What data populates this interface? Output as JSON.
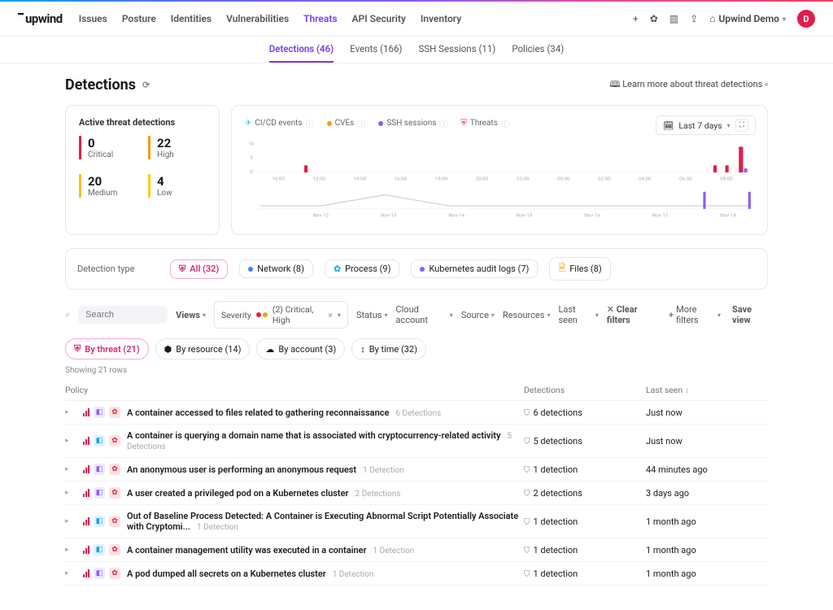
{
  "brand": "upwind",
  "nav": {
    "items": [
      {
        "label": "Issues"
      },
      {
        "label": "Posture"
      },
      {
        "label": "Identities"
      },
      {
        "label": "Vulnerabilities"
      },
      {
        "label": "Threats",
        "active": true
      },
      {
        "label": "API Security"
      },
      {
        "label": "Inventory"
      }
    ]
  },
  "header_right": {
    "org": "Upwind Demo",
    "avatar_initial": "D"
  },
  "subnav": {
    "items": [
      {
        "label": "Detections (46)",
        "active": true
      },
      {
        "label": "Events (166)"
      },
      {
        "label": "SSH Sessions (11)"
      },
      {
        "label": "Policies (34)"
      }
    ]
  },
  "page_title": "Detections",
  "learn_more": "Learn more about threat detections",
  "metrics": {
    "title": "Active threat detections",
    "critical": {
      "value": "0",
      "label": "Critical"
    },
    "high": {
      "value": "22",
      "label": "High"
    },
    "medium": {
      "value": "20",
      "label": "Medium"
    },
    "low": {
      "value": "4",
      "label": "Low"
    }
  },
  "chart_data": {
    "type": "bar",
    "title": "",
    "ylim": [
      0,
      10
    ],
    "legend": [
      "CI/CD events",
      "CVEs",
      "SSH sessions",
      "Threats"
    ],
    "legend_colors": {
      "CI/CD events": "#38bdf8",
      "CVEs": "#f59e0b",
      "SSH sessions": "#8b5cf6",
      "Threats": "#e11d48"
    },
    "timerange_label": "Last 7 days",
    "x_upper_ticks": [
      "10:00",
      "12:00",
      "14:00",
      "16:00",
      "18:00",
      "20:00",
      "22:00",
      "00:00",
      "02:00",
      "04:00",
      "06:00",
      "08:00"
    ],
    "x_lower_ticks": [
      "Nov 12",
      "Nov 13",
      "Nov 14",
      "Nov 15",
      "Nov 16",
      "Nov 17",
      "Nov 18"
    ],
    "series_upper": [
      {
        "name": "Threats",
        "values": [
          0,
          0,
          2,
          0,
          0,
          0,
          0,
          0,
          0,
          0,
          0,
          0,
          2,
          2,
          8
        ]
      },
      {
        "name": "SSH sessions",
        "values": [
          0,
          0,
          0,
          0,
          0,
          0,
          0,
          0,
          0,
          0,
          0,
          0,
          0,
          0,
          1
        ]
      }
    ],
    "series_lower": [
      {
        "name": "events",
        "values": [
          1,
          1,
          3,
          1,
          1,
          1,
          1,
          1,
          1
        ]
      },
      {
        "name": "SSH sessions",
        "values": [
          0,
          0,
          0,
          0,
          0,
          0,
          0,
          0,
          1
        ]
      }
    ]
  },
  "detection_type": {
    "label": "Detection type",
    "pills": [
      {
        "label": "All (32)",
        "active": true,
        "color": "#db2777"
      },
      {
        "label": "Network (8)",
        "color": "#3b82f6"
      },
      {
        "label": "Process (9)",
        "color": "#0ea5e9"
      },
      {
        "label": "Kubernetes audit logs (7)",
        "color": "#8b5cf6"
      },
      {
        "label": "Files (8)",
        "color": "#f59e0b"
      }
    ]
  },
  "filters": {
    "search_placeholder": "Search",
    "views": "Views",
    "severity_label": "Severity",
    "severity_value": "(2) Critical, High",
    "dd": [
      "Status",
      "Cloud account",
      "Source",
      "Resources",
      "Last seen"
    ],
    "clear": "Clear filters",
    "more": "More filters",
    "save": "Save view"
  },
  "grouping": {
    "tabs": [
      {
        "label": "By threat (21)",
        "active": true
      },
      {
        "label": "By resource (14)"
      },
      {
        "label": "By account (3)"
      },
      {
        "label": "By time (32)"
      }
    ]
  },
  "rows_count": "Showing 21 rows",
  "columns": {
    "policy": "Policy",
    "detections": "Detections",
    "last": "Last seen"
  },
  "rows": [
    {
      "icon_bg": "#ede9fe",
      "icon_fg": "#8b5cf6",
      "threat_bg": "#fee2e2",
      "title": "A container accessed to files related to gathering reconnaissance",
      "det_count": "6 Detections",
      "detections": "6 detections",
      "last": "Just now"
    },
    {
      "icon_bg": "#e0f2fe",
      "icon_fg": "#0ea5e9",
      "threat_bg": "#fee2e2",
      "title": "A container is querying a domain name that is associated with cryptocurrency-related activity",
      "det_count": "5 Detections",
      "detections": "5 detections",
      "last": "Just now"
    },
    {
      "icon_bg": "#ede9fe",
      "icon_fg": "#8b5cf6",
      "threat_bg": "#fee2e2",
      "title": "An anonymous user is performing an anonymous request",
      "det_count": "1 Detection",
      "detections": "1 detection",
      "last": "44 minutes ago"
    },
    {
      "icon_bg": "#ede9fe",
      "icon_fg": "#8b5cf6",
      "threat_bg": "#fee2e2",
      "title": "A user created a privileged pod on a Kubernetes cluster",
      "det_count": "2 Detections",
      "detections": "2 detections",
      "last": "3 days ago"
    },
    {
      "icon_bg": "#e0f2fe",
      "icon_fg": "#0ea5e9",
      "threat_bg": "#fee2e2",
      "title": "Out of Baseline Process Detected: A Container is Executing Abnormal Script Potentially Associate with Cryptomi...",
      "det_count": "1 Detection",
      "detections": "1 detection",
      "last": "1 month ago"
    },
    {
      "icon_bg": "#e0f2fe",
      "icon_fg": "#0ea5e9",
      "threat_bg": "#fee2e2",
      "title": "A container management utility was executed in a container",
      "det_count": "1 Detection",
      "detections": "1 detection",
      "last": "1 month ago"
    },
    {
      "icon_bg": "#ede9fe",
      "icon_fg": "#8b5cf6",
      "threat_bg": "#fee2e2",
      "title": "A pod dumped all secrets on a Kubernetes cluster",
      "det_count": "1 Detection",
      "detections": "1 detection",
      "last": "1 month ago"
    }
  ]
}
